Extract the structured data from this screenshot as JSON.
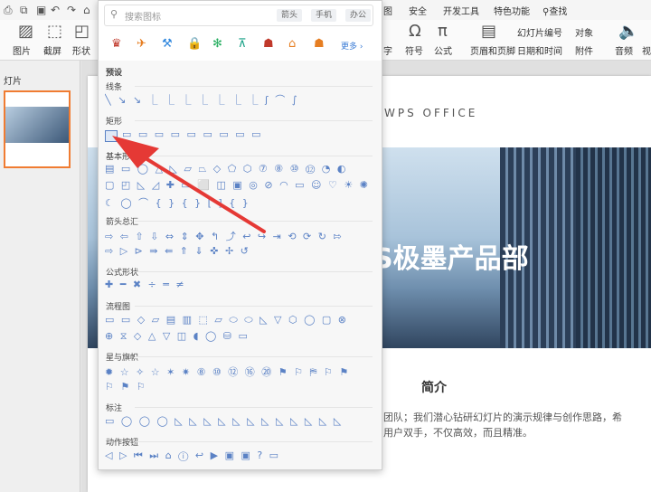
{
  "tabs": {
    "items": [
      "图",
      "安全",
      "开发工具",
      "特色功能",
      "查找"
    ]
  },
  "ribbon": {
    "left": [
      "图片",
      "截屏",
      "形状"
    ],
    "right": [
      "字",
      "符号",
      "公式",
      "页眉和页脚",
      "幻灯片编号",
      "日期和时间",
      "对象",
      "附件",
      "音频",
      "视"
    ]
  },
  "left_pane": {
    "label": "灯片"
  },
  "panel": {
    "search_placeholder": "搜索图标",
    "tags": [
      "箭头",
      "手机",
      "办公"
    ],
    "more_label": "更多",
    "preset_title": "预设",
    "sections": [
      {
        "title": "线条",
        "glyphs": "╲ ↘ ↘ ⎿ ⎿ ⎿ ⎿ ⎿ ⎿ ⎿ ʃ ⌒ ∫"
      },
      {
        "title": "矩形",
        "glyphs": "▭ ▭ ▭ ▭ ▭ ▭ ▭ ▭ ▭"
      },
      {
        "title": "基本形状",
        "glyphs": "▤ ▭ ◯ △ ◺ ▱ ⏢ ◇ ⬠ ⬡ ⑦ ⑧ ⑩ ⑫ ◔ ◐"
      },
      {
        "title": "",
        "glyphs": "▢ ◰ ◺ ◿ ✚ ▭ ⬜ ◫ ▣ ◎ ⊘ ◠ ▭ ☺ ♡ ☀ ✺"
      },
      {
        "title": "",
        "glyphs": "☾ ◯ ⌒ { } { } [ ] { }"
      },
      {
        "title": "箭头总汇",
        "glyphs": "⇨ ⇦ ⇧ ⇩ ⇔ ⇕ ✥ ↰ ⤴ ↩ ↪ ⇥ ⟲ ⟳ ↻ ⇰"
      },
      {
        "title": "",
        "glyphs": "⇨ ▷ ⊳ ⇛ ⇚ ⇑ ⇓ ✜ ✢ ↺"
      },
      {
        "title": "公式形状",
        "glyphs": "✚ ━ ✖ ÷ ═ ≠"
      },
      {
        "title": "流程图",
        "glyphs": "▭ ▭ ◇ ▱ ▤ ▥ ⬚ ▱ ⬭ ⬭ ◺ ▽ ⬡ ◯ ▢ ⊗"
      },
      {
        "title": "",
        "glyphs": "⊕ ⧖ ◇ △ ▽ ◫ ◖ ◯ ⛁ ▭"
      },
      {
        "title": "星与旗帜",
        "glyphs": "✹ ☆ ✧ ☆ ✶ ✷ ⑧ ⑩ ⑫ ⑯ ⑳ ⚑ ⚐ ⛿ ⚐ ⚑"
      },
      {
        "title": "",
        "glyphs": "⚐ ⚑ ⚐"
      },
      {
        "title": "标注",
        "glyphs": "▭ ◯ ◯ ◯ ◺ ◺ ◺ ◺ ◺ ◺ ◺ ◺ ◺ ◺ ◺ ◺"
      },
      {
        "title": "动作按钮",
        "glyphs": "◁ ▷ ⏮ ⏭ ⌂ ⓘ ↩ ▶ ▣ ▣ ? ▭"
      }
    ]
  },
  "slide": {
    "brand": "WPS  OFFICE",
    "headline": "S极墨产品部",
    "section_title": "简介",
    "body_line1": "团队；我们潜心钻研幻灯片的演示规律与创作思路，希",
    "body_line2": "用户双手，不仅高效，而且精准。"
  },
  "colors": {
    "accent": "#f07c32",
    "arrow": "#e53935",
    "shape_blue": "#5b82c5"
  }
}
